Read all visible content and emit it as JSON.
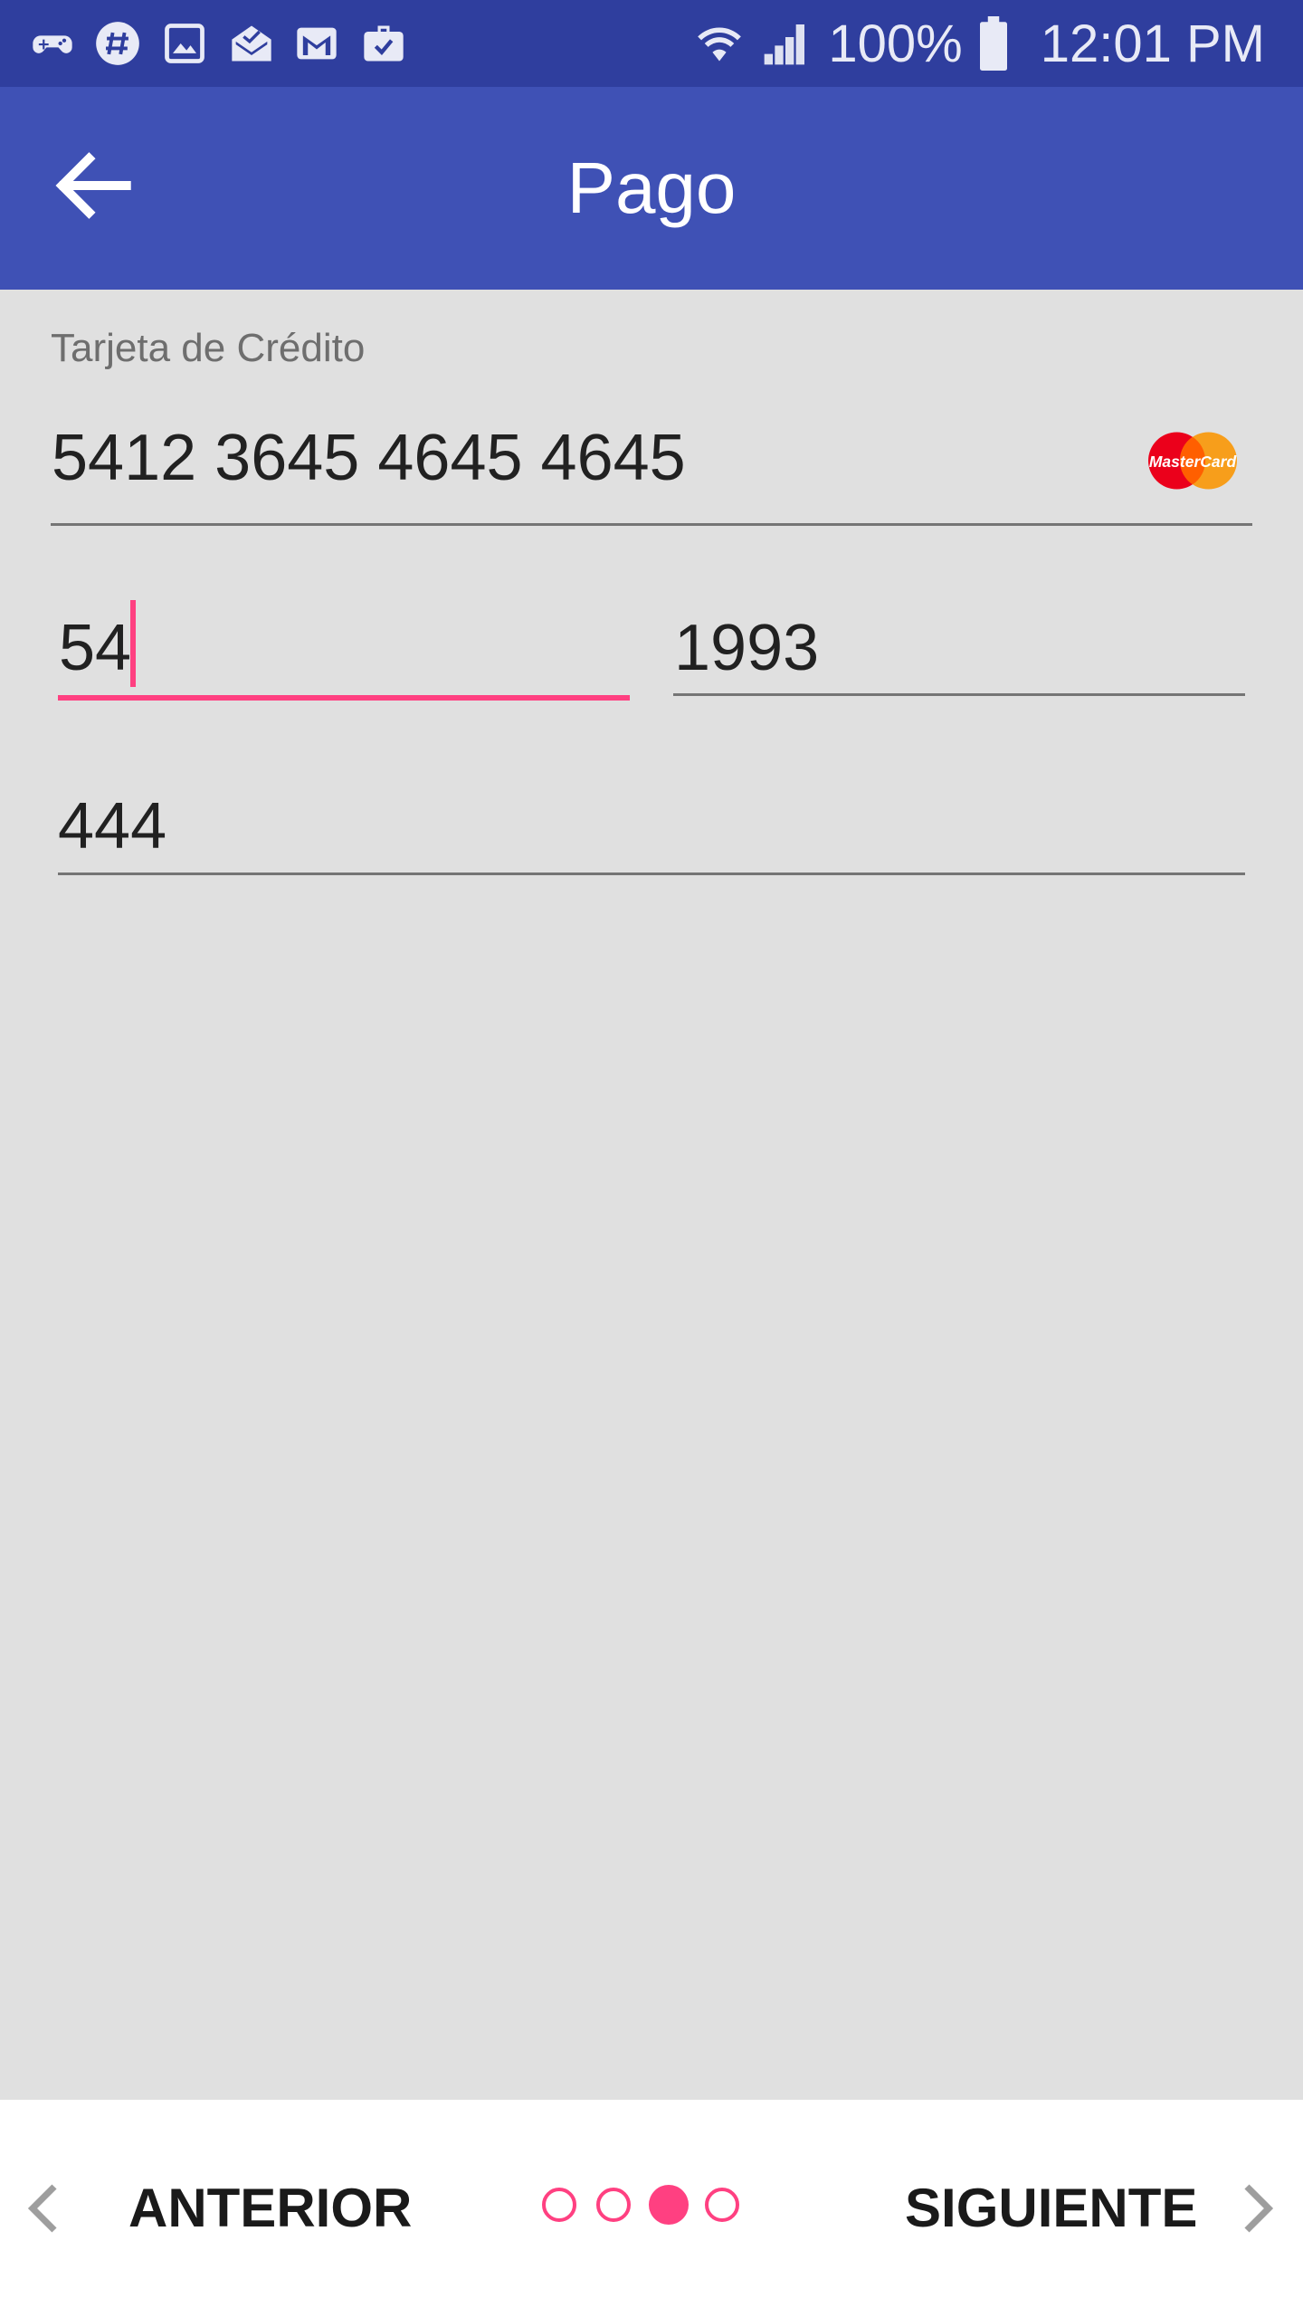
{
  "status_bar": {
    "battery": "100%",
    "time": "12:01 PM",
    "notification_icons": [
      "game-controller-icon",
      "slack-icon",
      "gallery-icon",
      "mail-open-icon",
      "gmail-icon",
      "briefcase-check-icon"
    ],
    "system_icons": [
      "wifi-icon",
      "signal-icon",
      "battery-icon"
    ]
  },
  "app_bar": {
    "title": "Pago",
    "back_icon": "arrow-back-icon"
  },
  "form": {
    "card_label": "Tarjeta de Crédito",
    "card_number": "5412 3645 4645 4645",
    "card_brand": "MasterCard",
    "month": "54",
    "year": "1993",
    "cvv": "444"
  },
  "bottom_nav": {
    "prev_label": "ANTERIOR",
    "next_label": "SIGUIENTE",
    "steps_total": 4,
    "current_step": 3
  },
  "colors": {
    "status_bar": "#2f3e9e",
    "app_bar": "#3f51b5",
    "accent": "#ff4081",
    "background": "#e0e0e0"
  }
}
